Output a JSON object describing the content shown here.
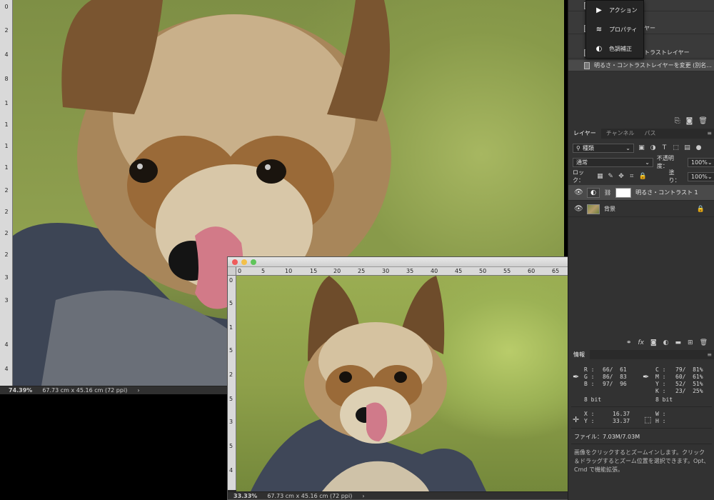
{
  "doc1": {
    "zoom": "74.39%",
    "doc_size": "67.73 cm x 45.16 cm (72 ppi)",
    "arrow": "›",
    "vruler_ticks": [
      "0",
      "2",
      "4",
      "8",
      "1",
      "1",
      "1",
      "1",
      "2",
      "2",
      "2",
      "2",
      "3",
      "3",
      "4",
      "4"
    ]
  },
  "doc2": {
    "zoom": "33.33%",
    "doc_size": "67.73 cm x 45.16 cm (72 ppi)",
    "arrow": "›",
    "hruler_ticks": [
      "0",
      "5",
      "10",
      "15",
      "20",
      "25",
      "30",
      "35",
      "40",
      "45",
      "50",
      "55",
      "60",
      "65"
    ],
    "vruler_ticks": [
      "0",
      "5",
      "1",
      "5",
      "2",
      "5",
      "3",
      "5",
      "4"
    ]
  },
  "history": {
    "rows": [
      {
        "label": ""
      },
      {
        "label": "ヤー"
      },
      {
        "label": "トラストレイヤー"
      },
      {
        "label": ""
      },
      {
        "label": "明るさ・コントラストレイヤーを変更 (別名..."
      }
    ]
  },
  "popup": {
    "items": [
      {
        "icon": "▶",
        "label": "アクション"
      },
      {
        "icon": "≋",
        "label": "プロパティ"
      },
      {
        "icon": "◐",
        "label": "色調補正"
      }
    ]
  },
  "layers_panel": {
    "tabs": [
      "レイヤー",
      "チャンネル",
      "パス"
    ],
    "filter_label": "種類",
    "blend_mode": "通常",
    "opacity_label": "不透明度：",
    "opacity_value": "100%",
    "lock_label": "ロック：",
    "fill_label": "塗り：",
    "fill_value": "100%",
    "layers": [
      {
        "name": "明るさ・コントラスト 1",
        "selected": true
      },
      {
        "name": "背景",
        "selected": false
      }
    ]
  },
  "info_panel": {
    "tab": "情報",
    "rgb_left": {
      "R": "66/  61",
      "G": "86/  83",
      "B": "97/  96"
    },
    "cmyk": {
      "C": "79/  81%",
      "M": "60/  61%",
      "Y": "52/  51%",
      "K": "23/  25%"
    },
    "bit_left": "8 bit",
    "bit_right": "8 bit",
    "x_value": "16.37",
    "y_value": "33.37",
    "w_label": "W :",
    "h_label": "H :",
    "file_info": "ファイル：7.03M/7.03M",
    "help_text": "画像をクリックするとズームインします。クリック＆ドラッグするとズーム位置を選択できます。Opt、Cmd で機能拡張。"
  }
}
